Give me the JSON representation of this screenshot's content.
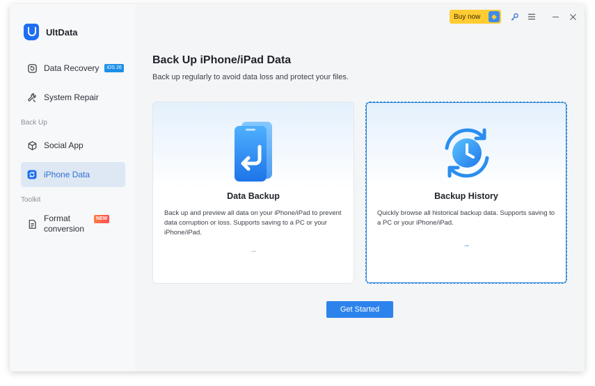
{
  "app": {
    "name": "UltData"
  },
  "sidebar": {
    "items": [
      {
        "label": "Data Recovery",
        "badge": "iOS 26"
      },
      {
        "label": "System Repair"
      },
      {
        "label": "Social App"
      },
      {
        "label": "iPhone Data"
      },
      {
        "label_line1": "Format",
        "label_line2": "conversion",
        "badge": "NEW"
      }
    ],
    "sections": {
      "backup": "Back Up",
      "toolkit": "Toolkit"
    }
  },
  "topbar": {
    "buy_label": "Buy now"
  },
  "main": {
    "title": "Back Up iPhone/iPad Data",
    "subtitle": "Back up regularly to avoid data loss and protect your files.",
    "cards": [
      {
        "title": "Data Backup",
        "desc": "Back up and preview all data on your iPhone/iPad to prevent data corruption or loss. Supports saving to a PC or your iPhone/iPad.",
        "arrow": "→"
      },
      {
        "title": "Backup History",
        "desc": "Quickly browse all historical backup data. Supports saving to a PC or your iPhone/iPad.",
        "arrow": "→"
      }
    ],
    "primary_button": "Get Started"
  },
  "colors": {
    "accent": "#2d83ec",
    "active_bg": "#dde8f4",
    "buy": "#ffcc33"
  }
}
